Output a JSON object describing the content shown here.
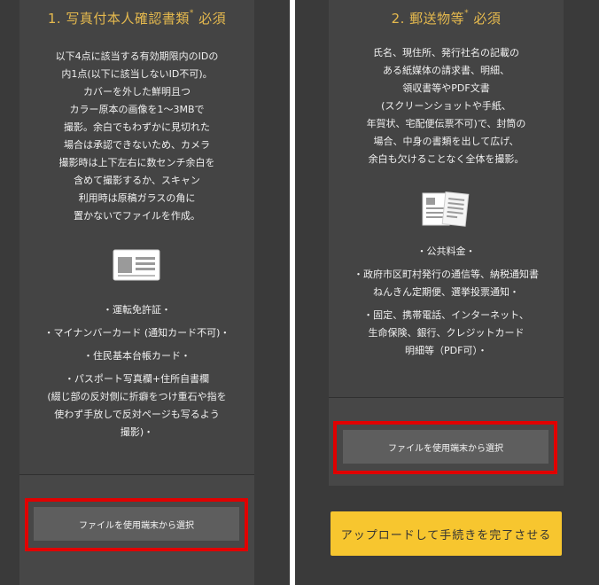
{
  "left_panel": {
    "title": "1. 写真付本人確認書類",
    "title_mark": "*",
    "title_suffix": " 必須",
    "description_lines": [
      "以下4点に該当する有効期限内のIDの",
      "内1点(以下に該当しないID不可)。",
      "カバーを外した鮮明且つ",
      "カラー原本の画像を1～3MBで",
      "撮影。余白でもわずかに見切れた",
      "場合は承認できないため、カメラ",
      "撮影時は上下左右に数センチ余白を",
      "含めて撮影するか、スキャン",
      "利用時は原稿ガラスの角に",
      "置かないでファイルを作成。"
    ],
    "icon": "id-card-icon",
    "documents": [
      [
        "・運転免許証・"
      ],
      [
        "・マイナンバーカード (通知カード不可)・"
      ],
      [
        "・住民基本台帳カード・"
      ],
      [
        "・パスポート写真欄+住所自書欄",
        "(綴じ部の反対側に折癖をつけ重石や指を",
        "使わず手放しで反対ページも写るよう",
        "撮影)・"
      ]
    ],
    "file_button_label": "ファイルを使用端末から選択"
  },
  "right_panel": {
    "title": "2. 郵送物等",
    "title_mark": "*",
    "title_suffix": " 必須",
    "description_lines": [
      "氏名、現住所、発行社名の記載の",
      "ある紙媒体の請求書、明細、",
      "領収書等やPDF文書",
      "(スクリーンショットや手紙、",
      "年賀状、宅配便伝票不可)で、封筒の",
      "場合、中身の書類を出して広げ、",
      "余白も欠けることなく全体を撮影。"
    ],
    "icon": "documents-icon",
    "documents": [
      [
        "・公共料金・"
      ],
      [
        "・政府市区町村発行の通信等、納税通知書",
        "ねんきん定期便、選挙投票通知・"
      ],
      [
        "・固定、携帯電話、インターネット、",
        "生命保険、銀行、クレジットカード",
        "明細等（PDF可）・"
      ]
    ],
    "file_button_label": "ファイルを使用端末から選択",
    "complete_button_label": "アップロードして手続きを完了させる"
  },
  "colors": {
    "background": "#3a3a3a",
    "card": "#444444",
    "accent_title": "#e5b94e",
    "highlight_frame": "#e00000",
    "primary_button": "#f7c62f"
  }
}
